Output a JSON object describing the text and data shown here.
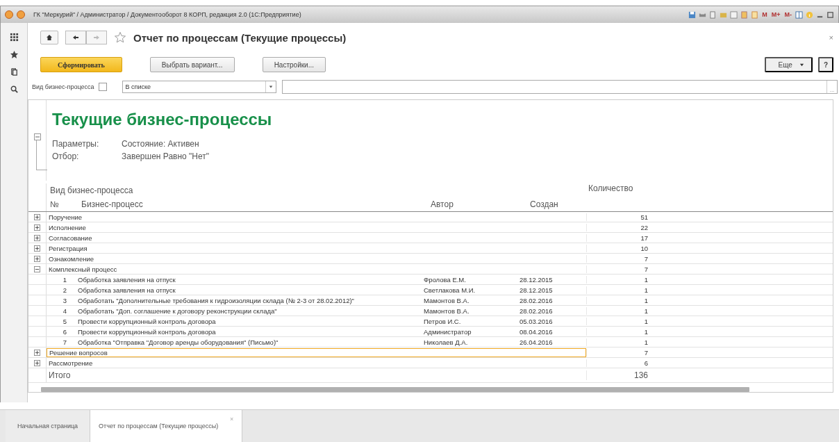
{
  "window": {
    "title": "ГК \"Меркурий\" / Администратор / Документооборот 8 КОРП, редакция 2.0  (1С:Предприятие)",
    "memory_buttons": [
      "M",
      "M+",
      "M-"
    ]
  },
  "form": {
    "title": "Отчет по процессам (Текущие процессы)",
    "close": "×"
  },
  "buttons": [
    {
      "label": "Сформировать",
      "kind": "primary"
    },
    {
      "label": "Выбрать вариант...",
      "kind": "normal"
    },
    {
      "label": "Настройки...",
      "kind": "normal"
    }
  ],
  "more_button": "Еще",
  "help_button": "?",
  "filter": {
    "label": "Вид бизнес-процесса",
    "checked": false,
    "mode": "В списке",
    "choose": "..."
  },
  "report": {
    "title": "Текущие бизнес-процессы",
    "parameters": [
      {
        "label": "Параметры:",
        "value": "Состояние: Активен"
      },
      {
        "label": "Отбор:",
        "value": "Завершен Равно \"Нет\""
      }
    ],
    "header": {
      "group": "Вид бизнес-процесса",
      "number": "№",
      "process": "Бизнес-процесс",
      "author": "Автор",
      "created": "Создан",
      "count": "Количество"
    },
    "groups": [
      {
        "name": "Поручение",
        "count": "51",
        "expanded": false,
        "selected": false
      },
      {
        "name": "Исполнение",
        "count": "22",
        "expanded": false,
        "selected": false
      },
      {
        "name": "Согласование",
        "count": "17",
        "expanded": false,
        "selected": false
      },
      {
        "name": "Регистрация",
        "count": "10",
        "expanded": false,
        "selected": false
      },
      {
        "name": "Ознакомление",
        "count": "7",
        "expanded": false,
        "selected": false
      },
      {
        "name": "Комплексный процесс",
        "count": "7",
        "expanded": true,
        "selected": false,
        "children": [
          {
            "number": "1",
            "process": "Обработка заявления на отпуск",
            "author": "Фролова Е.М.",
            "created": "28.12.2015",
            "count": "1"
          },
          {
            "number": "2",
            "process": "Обработка заявления на отпуск",
            "author": "Светлакова М.И.",
            "created": "28.12.2015",
            "count": "1"
          },
          {
            "number": "3",
            "process": "Обработать \"Дополнительные требования к гидроизоляции склада (№ 2-3 от 28.02.2012)\"",
            "author": "Мамонтов В.А.",
            "created": "28.02.2016",
            "count": "1"
          },
          {
            "number": "4",
            "process": "Обработать \"Доп. соглашение к договору реконструкции склада\"",
            "author": "Мамонтов В.А.",
            "created": "28.02.2016",
            "count": "1"
          },
          {
            "number": "5",
            "process": "Провести коррупционный контроль договора",
            "author": "Петров И.С.",
            "created": "05.03.2016",
            "count": "1"
          },
          {
            "number": "6",
            "process": "Провести коррупционный контроль договора",
            "author": "Администратор",
            "created": "08.04.2016",
            "count": "1"
          },
          {
            "number": "7",
            "process": "Обработка \"Отправка \"Договор аренды оборудования\" (Письмо)\"",
            "author": "Николаев Д.А.",
            "created": "26.04.2016",
            "count": "1"
          }
        ]
      },
      {
        "name": "Решение вопросов",
        "count": "7",
        "expanded": false,
        "selected": true
      },
      {
        "name": "Рассмотрение",
        "count": "6",
        "expanded": false,
        "selected": false
      }
    ],
    "total": {
      "label": "Итого",
      "value": "136"
    }
  },
  "tabs": [
    {
      "label": "Начальная страница",
      "selected": false
    },
    {
      "label": "Отчет по процессам (Текущие процессы)",
      "selected": true,
      "close": "×"
    }
  ]
}
